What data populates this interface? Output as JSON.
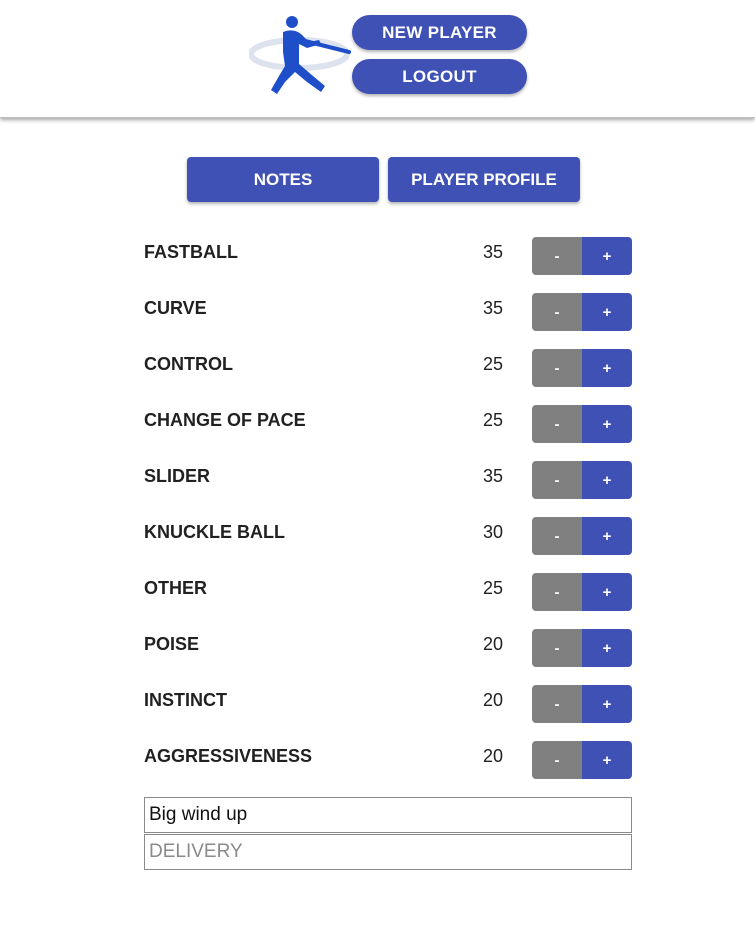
{
  "header": {
    "new_player_label": "NEW PLAYER",
    "logout_label": "LOGOUT",
    "logo_icon": "baseball-batter-icon"
  },
  "tabs": {
    "notes_label": "NOTES",
    "profile_label": "PLAYER PROFILE"
  },
  "stats": [
    {
      "label": "FASTBALL",
      "value": "35"
    },
    {
      "label": "CURVE",
      "value": "35"
    },
    {
      "label": "CONTROL",
      "value": "25"
    },
    {
      "label": "CHANGE OF PACE",
      "value": "25"
    },
    {
      "label": "SLIDER",
      "value": "35"
    },
    {
      "label": "KNUCKLE BALL",
      "value": "30"
    },
    {
      "label": "OTHER",
      "value": "25"
    },
    {
      "label": "POISE",
      "value": "20"
    },
    {
      "label": "INSTINCT",
      "value": "20"
    },
    {
      "label": "AGGRESSIVENESS",
      "value": "20"
    }
  ],
  "stepper": {
    "minus_label": "-",
    "plus_label": "+"
  },
  "delivery_input": {
    "value": "Big wind up"
  },
  "delivery_field": {
    "placeholder": "DELIVERY"
  },
  "colors": {
    "primary": "#3f51b5",
    "minus_gray": "#808080"
  }
}
